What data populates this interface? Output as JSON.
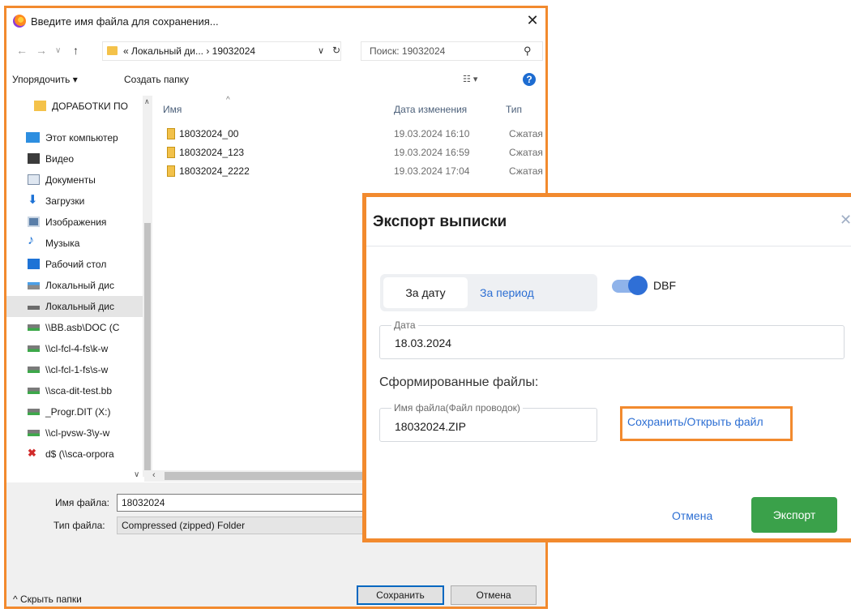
{
  "save_dialog": {
    "title": "Введите имя файла для сохранения...",
    "close_label": "✕",
    "path": "«  Локальный ди...  ›  19032024",
    "search_placeholder": "Поиск: 19032024",
    "organize_label": "Упорядочить ▾",
    "new_folder_label": "Создать папку",
    "nav_items": [
      {
        "label": "ДОРАБОТКИ ПО",
        "icon": "folder-icon"
      },
      {
        "label": "Этот компьютер",
        "icon": "computer-icon"
      },
      {
        "label": "Видео",
        "icon": "video-icon"
      },
      {
        "label": "Документы",
        "icon": "documents-icon"
      },
      {
        "label": "Загрузки",
        "icon": "downloads-icon"
      },
      {
        "label": "Изображения",
        "icon": "images-icon"
      },
      {
        "label": "Музыка",
        "icon": "music-icon"
      },
      {
        "label": "Рабочий стол",
        "icon": "desktop-icon"
      },
      {
        "label": "Локальный дис",
        "icon": "drive-icon"
      },
      {
        "label": "Локальный дис",
        "icon": "drive-icon"
      },
      {
        "label": "\\\\BB.asb\\DOC (C",
        "icon": "network-drive-icon"
      },
      {
        "label": "\\\\cl-fcl-4-fs\\k-w",
        "icon": "network-drive-icon"
      },
      {
        "label": "\\\\cl-fcl-1-fs\\s-w",
        "icon": "network-drive-icon"
      },
      {
        "label": "\\\\sca-dit-test.bb",
        "icon": "network-drive-icon"
      },
      {
        "label": "_Progr.DIT (X:)",
        "icon": "network-drive-icon"
      },
      {
        "label": "\\\\cl-pvsw-3\\y-w",
        "icon": "network-drive-icon"
      },
      {
        "label": "d$ (\\\\sca-orpora",
        "icon": "disconnected-drive-icon"
      }
    ],
    "columns": {
      "name": "Имя",
      "date": "Дата изменения",
      "type": "Тип"
    },
    "files": [
      {
        "name": "18032024_00",
        "date": "19.03.2024 16:10",
        "type": "Сжатая Z"
      },
      {
        "name": "18032024_123",
        "date": "19.03.2024 16:59",
        "type": "Сжатая Z"
      },
      {
        "name": "18032024_2222",
        "date": "19.03.2024 17:04",
        "type": "Сжатая Z"
      }
    ],
    "filename_label": "Имя файла:",
    "filename_value": "18032024",
    "filetype_label": "Тип файла:",
    "filetype_value": "Compressed (zipped) Folder",
    "hide_folders_label": "^  Скрыть папки",
    "save_button": "Сохранить",
    "cancel_button": "Отмена"
  },
  "export_modal": {
    "title": "Экспорт выписки",
    "close_label": "✕",
    "tab_date": "За дату",
    "tab_period": "За период",
    "toggle_label": "DBF",
    "toggle_on": true,
    "date_label": "Дата",
    "date_value": "18.03.2024",
    "files_heading": "Сформированные файлы:",
    "filename_label": "Имя файла(Файл проводок)",
    "filename_value": "18032024.ZIP",
    "open_link": "Сохранить/Открыть файл",
    "cancel_button": "Отмена",
    "export_button": "Экспорт"
  },
  "colors": {
    "highlight": "#f28a2e",
    "link": "#2d6fd3",
    "export_green": "#3aa14a"
  }
}
